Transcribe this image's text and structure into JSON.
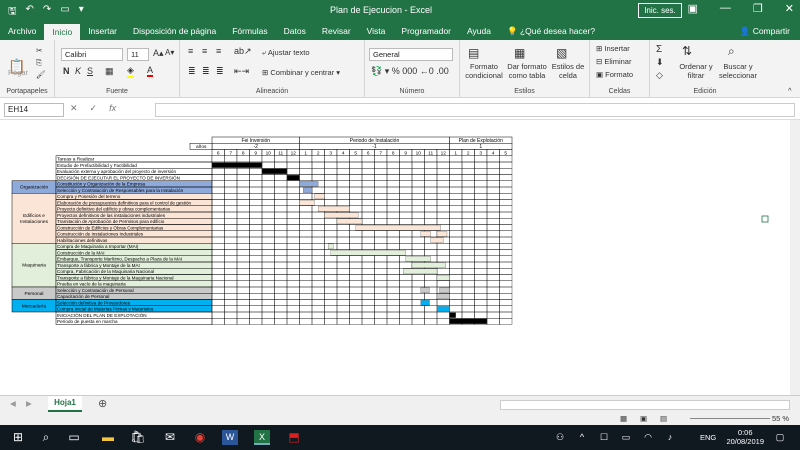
{
  "window": {
    "title": "Plan de Ejecucion  -  Excel",
    "signin": "Inic. ses."
  },
  "tabs": [
    "Archivo",
    "Inicio",
    "Insertar",
    "Disposición de página",
    "Fórmulas",
    "Datos",
    "Revisar",
    "Vista",
    "Programador",
    "Ayuda"
  ],
  "tell_me": "¿Qué desea hacer?",
  "share": "Compartir",
  "ribbon": {
    "clipboard": {
      "label": "Portapapeles",
      "paste": "Pegar"
    },
    "font": {
      "label": "Fuente",
      "name": "Calibri",
      "size": "11",
      "bold": "N",
      "italic": "K",
      "underline": "S"
    },
    "alignment": {
      "label": "Alineación",
      "wrap": "Ajustar texto",
      "merge": "Combinar y centrar"
    },
    "number": {
      "label": "Número",
      "format": "General"
    },
    "styles": {
      "label": "Estilos",
      "cond": "Formato condicional",
      "table": "Dar formato como tabla",
      "cell": "Estilos de celda"
    },
    "cells": {
      "label": "Celdas",
      "insert": "Insertar",
      "delete": "Eliminar",
      "format": "Formato"
    },
    "editing": {
      "label": "Edición",
      "sort": "Ordenar y filtrar",
      "find": "Buscar y seleccionar"
    }
  },
  "formula_bar": {
    "name_box": "EH14",
    "value": ""
  },
  "sheet_tab": "Hoja1",
  "zoom": "55 %",
  "taskbar": {
    "lang": "ENG",
    "time": "0:06",
    "date": "20/08/2019"
  },
  "gantt": {
    "periods": [
      {
        "name": "Fei Inversión",
        "sub": "-2",
        "months": [
          "6",
          "7",
          "8",
          "9",
          "10",
          "11",
          "12"
        ]
      },
      {
        "name": "Periodo de Instalación",
        "sub": "-1",
        "months": [
          "1",
          "2",
          "3",
          "4",
          "5",
          "6",
          "7",
          "8",
          "9",
          "10",
          "11",
          "12"
        ]
      },
      {
        "name": "Plan de Explotación",
        "sub": "1",
        "months": [
          "1",
          "2",
          "3",
          "4",
          "5"
        ]
      }
    ],
    "years_label": "años",
    "tasks_header": "Tareas a Realizar",
    "groups": [
      {
        "name": "Organización",
        "color": "#8eaadb",
        "rows": 2
      },
      {
        "name": "Edificios e Instalaciones",
        "color": "#fbe5d6",
        "rows": 8
      },
      {
        "name": "Maquinaria",
        "color": "#e2efda",
        "rows": 7
      },
      {
        "name": "Personal",
        "color": "#c9c9c9",
        "rows": 2
      },
      {
        "name": "Mercadería",
        "color": "#00b0f0",
        "rows": 2
      }
    ],
    "tasks": [
      {
        "text": "Estudio de Prefactibilidad y Factibilidad",
        "bars": [
          [
            0,
            4,
            "#000000"
          ]
        ]
      },
      {
        "text": "Evaluación externa y aprobación del proyecto de inversión",
        "bars": [
          [
            4,
            6,
            "#000000"
          ]
        ]
      },
      {
        "text": "DECISIÓN DE EJECUTAR EL PROYECTO DE INVERSIÓN",
        "bars": [
          [
            6,
            7,
            "#000000"
          ]
        ]
      },
      {
        "text": "Constitución y Organización de la Empresa",
        "bars": [
          [
            7,
            8.5,
            "#8eaadb"
          ]
        ]
      },
      {
        "text": "Selección y Contratación de Responsables para la Instalación",
        "bars": [
          [
            7.3,
            8,
            "#8eaadb"
          ]
        ]
      },
      {
        "text": "Compra y Posesión del terreno",
        "bars": [
          [
            8.2,
            9,
            "#fbe5d6"
          ]
        ]
      },
      {
        "text": "Elaboración de presupuestos definitivos para el control de gestión",
        "bars": [
          [
            7,
            8.2,
            "#fbe5d6"
          ]
        ]
      },
      {
        "text": "Proyecto definitivo del edificio y obras complementarias",
        "bars": [
          [
            8.5,
            11,
            "#fbe5d6"
          ]
        ]
      },
      {
        "text": "Proyectos definitivos de las instalaciones industriales",
        "bars": [
          [
            9,
            11.7,
            "#fbe5d6"
          ]
        ]
      },
      {
        "text": "Tramitación de Aprobación de Permisos para edificio",
        "bars": [
          [
            10,
            12,
            "#fbe5d6"
          ]
        ]
      },
      {
        "text": "Construcción de Edificios y Obras Complementarias",
        "bars": [
          [
            11.5,
            18.3,
            "#fbe5d6"
          ]
        ]
      },
      {
        "text": "Construcción de Instalaciones Industriales",
        "bars": [
          [
            16.7,
            17.5,
            "#fbe5d6"
          ],
          [
            18,
            18.8,
            "#fbe5d6"
          ]
        ]
      },
      {
        "text": "Habilitaciones definitivas",
        "bars": [
          [
            17.5,
            18.5,
            "#fbe5d6"
          ]
        ]
      },
      {
        "text": "Compra de Maquinaria a Importar (MAI)",
        "bars": [
          [
            9.3,
            9.7,
            "#e2efda"
          ]
        ]
      },
      {
        "text": "Construcción de la MAI",
        "bars": [
          [
            9.5,
            15.5,
            "#e2efda"
          ]
        ]
      },
      {
        "text": "Embarque, Transporte Marítimo, Despacho a Plaza de la MAI",
        "bars": [
          [
            15.5,
            17.5,
            "#e2efda"
          ]
        ]
      },
      {
        "text": "Transporte a fábrica y Montaje de la MAI",
        "bars": [
          [
            16,
            18.7,
            "#e2efda"
          ]
        ]
      },
      {
        "text": "Compra, Fabricación de la Maquinaria Nacional",
        "bars": [
          [
            15.3,
            18,
            "#e2efda"
          ]
        ]
      },
      {
        "text": "Transporte a fábrica y Montaje de la Maquinaria Nacional",
        "bars": [
          [
            18,
            19,
            "#e2efda"
          ]
        ]
      },
      {
        "text": "Prueba en vacío de la maquinaria",
        "bars": []
      },
      {
        "text": "Selección y Contratación de Personal",
        "bars": [
          [
            16.7,
            17.4,
            "#c9c9c9"
          ],
          [
            18.2,
            19,
            "#c9c9c9"
          ]
        ]
      },
      {
        "text": "Capacitación de Personal",
        "bars": [
          [
            18,
            19,
            "#c9c9c9"
          ]
        ]
      },
      {
        "text": "Selección definitiva de Proveedores",
        "bars": [
          [
            16.7,
            17.4,
            "#00b0f0"
          ]
        ]
      },
      {
        "text": "Compra Inicial de Materias Primas y Materiales",
        "bars": [
          [
            18,
            19,
            "#00b0f0"
          ]
        ]
      },
      {
        "text": "INICIACIÓN DEL PLAN DE EXPLOTACIÓN",
        "bars": [
          [
            19,
            19.5,
            "#000000"
          ]
        ]
      },
      {
        "text": "Período de puesta en marcha",
        "bars": [
          [
            19,
            22,
            "#000000"
          ]
        ]
      }
    ]
  }
}
